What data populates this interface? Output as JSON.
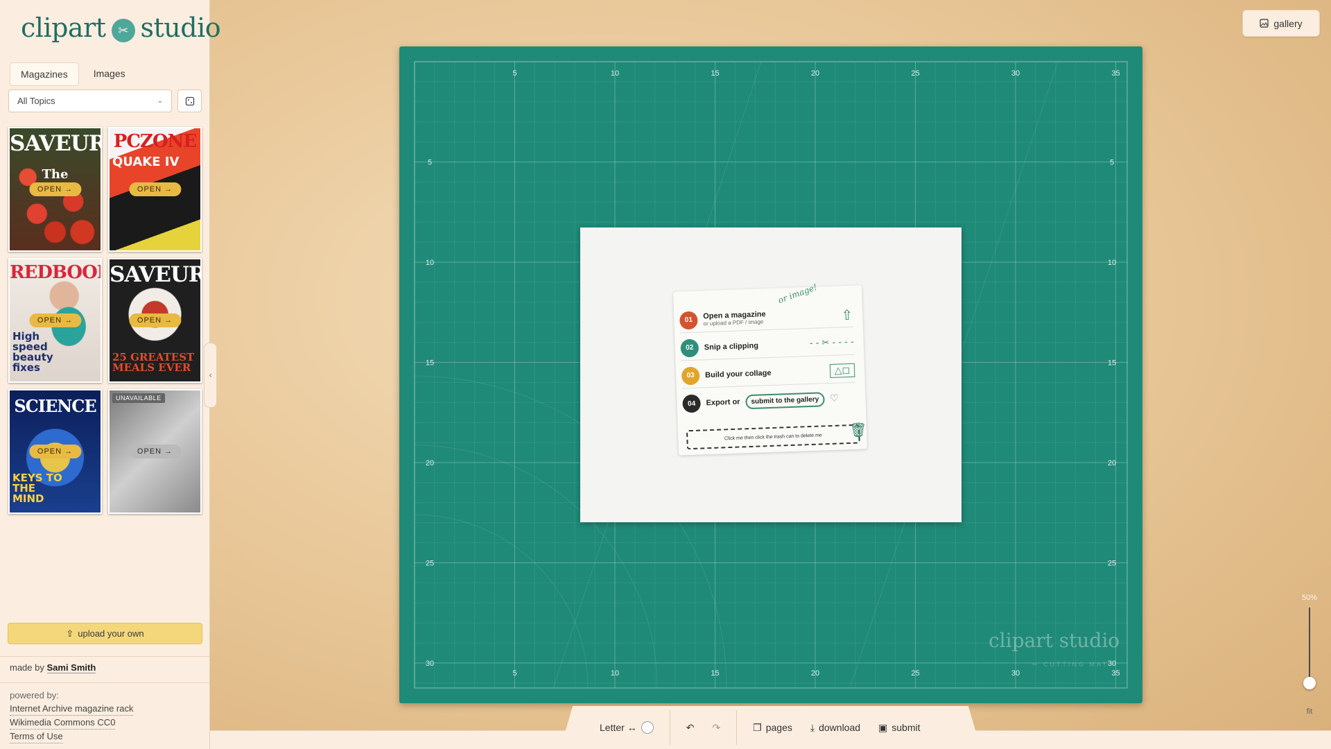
{
  "app": {
    "logo_left": "clipart",
    "logo_right": "studio"
  },
  "sidebar": {
    "tabs": [
      {
        "label": "Magazines",
        "active": true
      },
      {
        "label": "Images",
        "active": false
      }
    ],
    "topic_select": "All Topics",
    "magazines": [
      {
        "title": "SAVEUR",
        "subtitle": "The",
        "open_label": "OPEN →",
        "colors": [
          "#b8281f",
          "#ffffff"
        ]
      },
      {
        "title": "PCZONE",
        "subtitle": "QUAKE IV",
        "open_label": "OPEN →",
        "colors": [
          "#d62020",
          "#111111"
        ]
      },
      {
        "title": "REDBOOK",
        "subtitle": "High speed beauty fixes",
        "open_label": "OPEN →",
        "colors": [
          "#d9263c",
          "#ffffff"
        ]
      },
      {
        "title": "SAVEUR",
        "subtitle": "25 GREATEST MEALS EVER",
        "open_label": "OPEN →",
        "colors": [
          "#2b2b2b",
          "#ffffff"
        ]
      },
      {
        "title": "SCIENCE",
        "subtitle": "KEYS TO THE MIND",
        "open_label": "OPEN →",
        "colors": [
          "#1c3c8c",
          "#ffd23c"
        ]
      },
      {
        "title": "",
        "subtitle": "",
        "open_label": "OPEN →",
        "badge": "UNAVAILABLE",
        "colors": [
          "#9a9a9a",
          "#eeeeee"
        ]
      }
    ],
    "upload_label": "upload your own",
    "made_by_prefix": "made by",
    "made_by_name": "Sami Smith",
    "powered_by_label": "powered by:",
    "powered_links": [
      "Internet Archive magazine rack",
      "Wikimedia Commons CC0",
      "Terms of Use"
    ]
  },
  "header": {
    "gallery_label": "gallery"
  },
  "mat": {
    "ruler_top": [
      "5",
      "10",
      "15",
      "20",
      "25",
      "30",
      "35"
    ],
    "ruler_side": [
      "5",
      "10",
      "15",
      "20",
      "25",
      "30"
    ],
    "watermark": "clipart studio",
    "watermark_sub": "✂ CUTTING MAT"
  },
  "note": {
    "steps": [
      {
        "num": "01",
        "label": "Open a magazine",
        "sub": "or upload a PDF / image",
        "color": "#d2542e"
      },
      {
        "num": "02",
        "label": "Snip a clipping",
        "sub": "",
        "color": "#2e8f7a"
      },
      {
        "num": "03",
        "label": "Build your collage",
        "sub": "",
        "color": "#e0a52a"
      },
      {
        "num": "04",
        "label": "Export or",
        "sub": "",
        "color": "#2a2a2a"
      }
    ],
    "submit_scribble": "submit to the gallery",
    "or_image_scribble": "or image!",
    "hint": "Click me then click the trash can to delete me"
  },
  "toolbar": {
    "paper_size": "Letter ↔",
    "pages_label": "pages",
    "download_label": "download",
    "submit_label": "submit"
  },
  "zoom": {
    "level": "50%",
    "fit_label": "fit",
    "slider_position": 0.08
  }
}
